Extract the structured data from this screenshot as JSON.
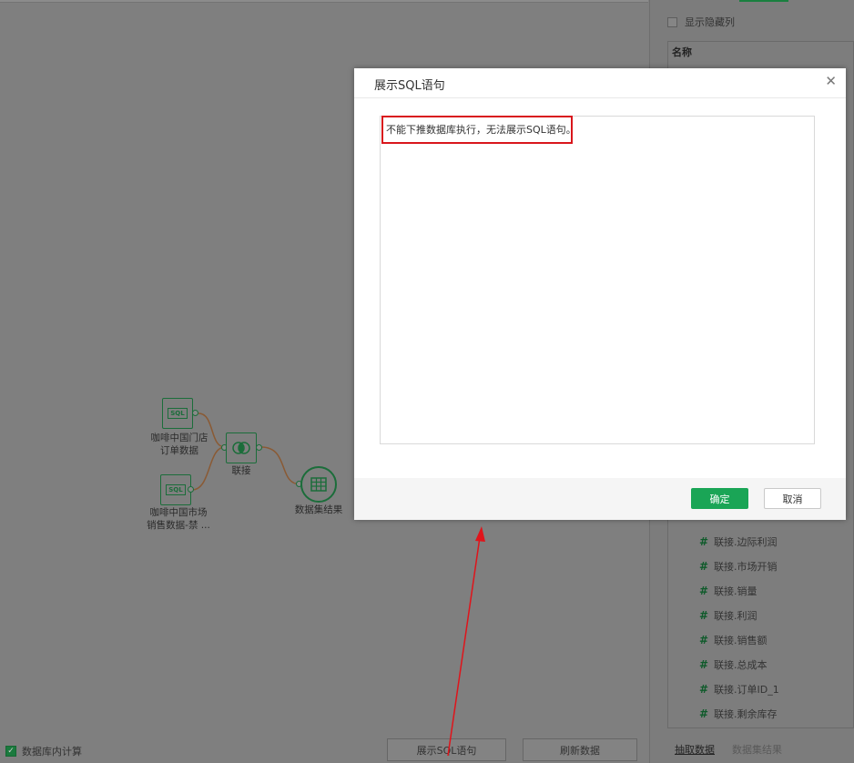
{
  "right_panel": {
    "show_hidden_label": "显示隐藏列",
    "column_header": "名称",
    "fields": [
      "联接.边际利润",
      "联接.市场开销",
      "联接.销量",
      "联接.利润",
      "联接.销售额",
      "联接.总成本",
      "联接.订单ID_1",
      "联接.剩余库存"
    ],
    "tabs": [
      "抽取数据",
      "数据集结果"
    ]
  },
  "flow": {
    "node1_line1": "咖啡中国门店",
    "node1_line2": "订单数据",
    "node2_line1": "咖啡中国市场",
    "node2_line2": "销售数据-禁 ...",
    "join_label": "联接",
    "result_label": "数据集结果"
  },
  "footer": {
    "db_compute_label": "数据库内计算",
    "show_sql_button": "展示SQL语句",
    "refresh_button": "刷新数据"
  },
  "dialog": {
    "title": "展示SQL语句",
    "message": "不能下推数据库执行，无法展示SQL语句。",
    "ok_button": "确定",
    "cancel_button": "取消"
  },
  "colors": {
    "accent_green": "#1aa556",
    "highlight_red": "#d9161c",
    "arrow_red": "#e0141b"
  }
}
